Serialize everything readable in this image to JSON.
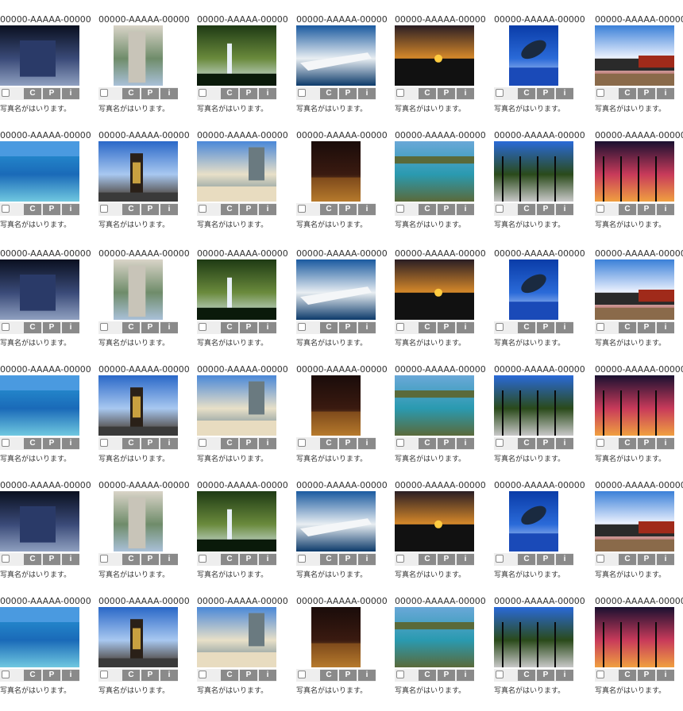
{
  "grid": {
    "code_label": "00000-AAAAA-00000",
    "name_label": "写真名がはいります。",
    "btn_copy": "C",
    "btn_print": "P",
    "btn_info": "i",
    "checkbox_checked": false
  },
  "photos": [
    {
      "id": "airplane-seat",
      "orientation": "landscape",
      "colors": [
        "#0a1020",
        "#3a4a78",
        "#8fa0c0"
      ]
    },
    {
      "id": "hotel-tower",
      "orientation": "portrait",
      "colors": [
        "#d9d4c8",
        "#6f8c6a",
        "#a9c0d8"
      ]
    },
    {
      "id": "waterfall",
      "orientation": "landscape",
      "colors": [
        "#1e3a14",
        "#6a8a3c",
        "#d8e8f0"
      ]
    },
    {
      "id": "cruise-ship",
      "orientation": "landscape",
      "colors": [
        "#1a5aa0",
        "#e8eef2",
        "#0c3a6a"
      ]
    },
    {
      "id": "sunset-horizon",
      "orientation": "landscape",
      "colors": [
        "#2a1e24",
        "#d88a2a",
        "#7a7a90"
      ]
    },
    {
      "id": "humpback-whale",
      "orientation": "portrait",
      "colors": [
        "#0a3ca8",
        "#2a6ad8",
        "#e8f0ff"
      ]
    },
    {
      "id": "steam-train",
      "orientation": "landscape",
      "colors": [
        "#3a80d8",
        "#f0f4ff",
        "#a02a1a"
      ]
    },
    {
      "id": "ocean-coast",
      "orientation": "landscape",
      "colors": [
        "#2a9ad8",
        "#1a6ab8",
        "#70c8e0"
      ]
    },
    {
      "id": "king-statue",
      "orientation": "landscape",
      "colors": [
        "#2a68c8",
        "#a8c8f0",
        "#3a2a1a"
      ]
    },
    {
      "id": "beach-hotels",
      "orientation": "landscape",
      "colors": [
        "#4a88d8",
        "#e8e0c8",
        "#5a7a8a"
      ]
    },
    {
      "id": "city-night",
      "orientation": "portrait",
      "colors": [
        "#1a0c0a",
        "#3a1a10",
        "#d8a040"
      ]
    },
    {
      "id": "bay-cove",
      "orientation": "landscape",
      "colors": [
        "#6aa8d8",
        "#2a9ab0",
        "#5a6a3a"
      ]
    },
    {
      "id": "palm-street",
      "orientation": "landscape",
      "colors": [
        "#2a6ad8",
        "#2a4a1a",
        "#c8c8c8"
      ]
    },
    {
      "id": "palm-sunset",
      "orientation": "landscape",
      "colors": [
        "#1a1030",
        "#c83a5a",
        "#f0a040"
      ]
    }
  ]
}
